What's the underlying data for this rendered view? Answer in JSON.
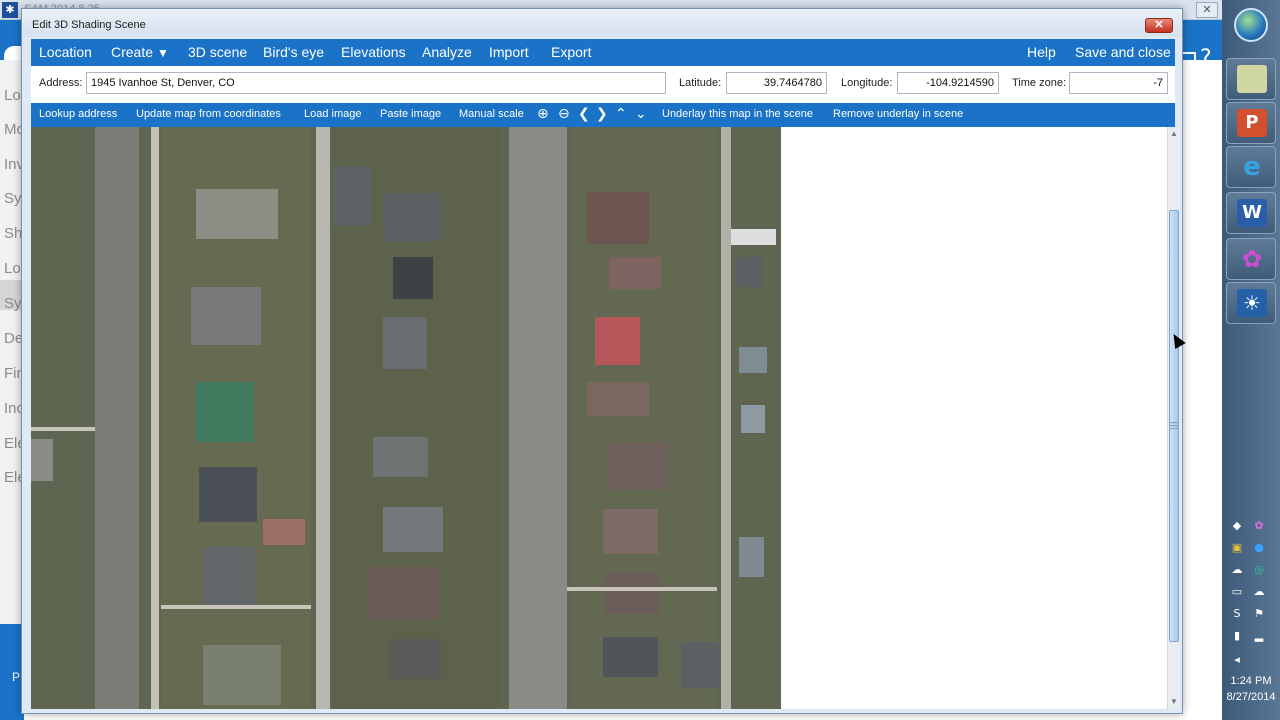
{
  "background_app": {
    "title": "SAM 2014.8.25",
    "close_label": "✕",
    "help_icon": "?",
    "side_items": [
      "Lo",
      "Mo",
      "Inv",
      "Sys",
      "Sha",
      "Lo",
      "Sys",
      "De",
      "Fin",
      "Inc",
      "Ele",
      "Ele"
    ],
    "bottom_char": "P"
  },
  "dialog": {
    "title": "Edit 3D Shading Scene",
    "close_label": "✕",
    "menu": {
      "location": "Location",
      "create": "Create",
      "scene_3d": "3D scene",
      "birds_eye": "Bird's eye",
      "elevations": "Elevations",
      "analyze": "Analyze",
      "import": "Import",
      "export": "Export",
      "help": "Help",
      "save_close": "Save and close"
    },
    "address_row": {
      "address_label": "Address:",
      "address_value": "1945 Ivanhoe St, Denver, CO",
      "latitude_label": "Latitude:",
      "latitude_value": "39.7464780",
      "longitude_label": "Longitude:",
      "longitude_value": "-104.9214590",
      "timezone_label": "Time zone:",
      "timezone_value": "-7"
    },
    "toolbar": {
      "lookup": "Lookup address",
      "update_map": "Update map from coordinates",
      "load_image": "Load image",
      "paste_image": "Paste image",
      "manual_scale": "Manual scale",
      "zoom_in": "⊕",
      "zoom_out": "⊖",
      "pan_left": "❮",
      "pan_right": "❯",
      "pan_up": "⌃",
      "pan_down": "⌄",
      "underlay": "Underlay this map in the scene",
      "remove_underlay": "Remove underlay in scene"
    },
    "map": {
      "imagery": "aerial photo of residential blocks"
    }
  },
  "taskbar": {
    "apps": [
      "powerpoint",
      "internet-explorer",
      "word",
      "flower-app",
      "sun-app"
    ],
    "time": "1:24 PM",
    "date": "8/27/2014"
  }
}
